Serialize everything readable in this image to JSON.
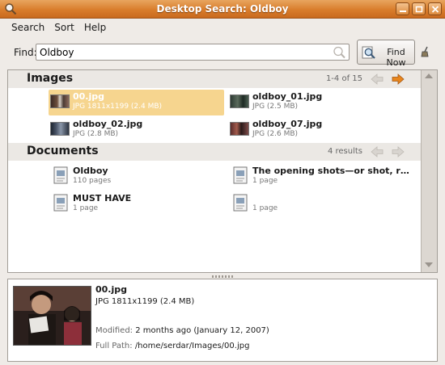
{
  "window": {
    "title": "Desktop Search: Oldboy"
  },
  "menu": [
    "Search",
    "Sort",
    "Help"
  ],
  "find": {
    "label": "Find:",
    "value": "Oldboy",
    "button": "Find Now"
  },
  "images": {
    "heading": "Images",
    "count": "1-4 of 15",
    "items": [
      {
        "name": "00.jpg",
        "meta": "JPG 1811x1199 (2.4 MB)"
      },
      {
        "name": "oldboy_01.jpg",
        "meta": "JPG (2.5 MB)"
      },
      {
        "name": "oldboy_02.jpg",
        "meta": "JPG (2.8 MB)"
      },
      {
        "name": "oldboy_07.jpg",
        "meta": "JPG (2.6 MB)"
      }
    ]
  },
  "documents": {
    "heading": "Documents",
    "count": "4 results",
    "items": [
      {
        "name": "Oldboy",
        "meta": "110 pages"
      },
      {
        "name": "The opening shots—or shot, ra...",
        "meta": "1 page"
      },
      {
        "name": "MUST HAVE",
        "meta": "1 page"
      },
      {
        "name": "",
        "meta": "1 page"
      }
    ]
  },
  "details": {
    "name": "00.jpg",
    "type": "JPG 1811x1199 (2.4 MB)",
    "modified_label": "Modified:",
    "modified_value": "2 months ago (January 12, 2007)",
    "path_label": "Full Path:",
    "path_value": "/home/serdar/Images/00.jpg"
  },
  "colors": {
    "titlebar": "#d97d2c",
    "selection": "#f6d58f",
    "nav_arrow_active": "#e8861e"
  },
  "icons": [
    "search-app-icon",
    "minimize-icon",
    "maximize-icon",
    "close-icon",
    "magnifier-icon",
    "clear-broom-icon",
    "arrow-left-icon",
    "arrow-right-icon",
    "document-icon"
  ]
}
